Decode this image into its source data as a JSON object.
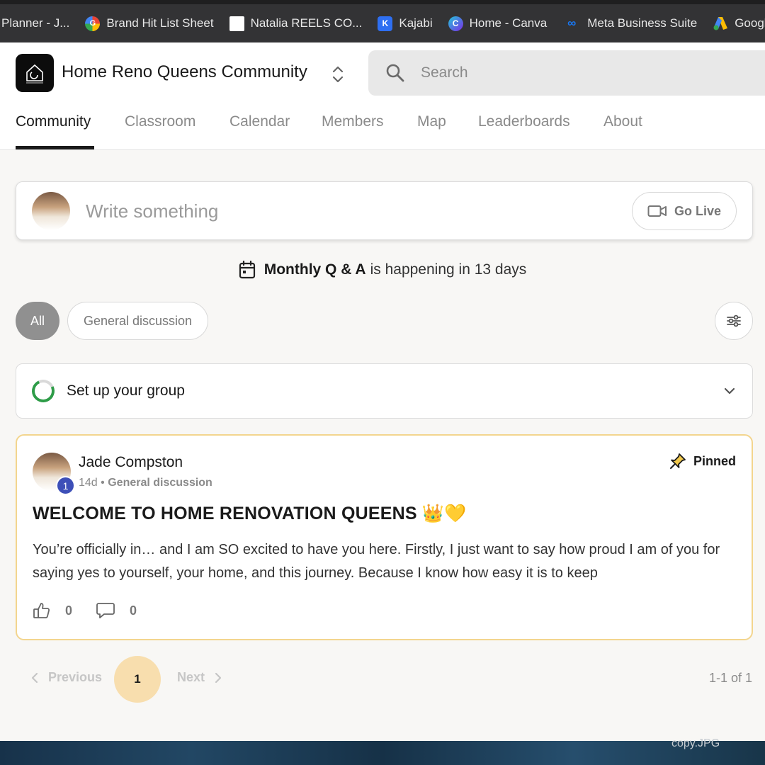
{
  "bookmarks": [
    {
      "label": "Planner - J...",
      "icon": "none"
    },
    {
      "label": "Brand Hit List Sheet",
      "icon": "google-icon"
    },
    {
      "label": "Natalia REELS CO...",
      "icon": "page-icon"
    },
    {
      "label": "Kajabi",
      "icon": "kajabi-icon"
    },
    {
      "label": "Home - Canva",
      "icon": "canva-icon"
    },
    {
      "label": "Meta Business Suite",
      "icon": "meta-icon"
    },
    {
      "label": "Google",
      "icon": "google-ads-icon"
    }
  ],
  "header": {
    "group_name": "Home Reno Queens Community",
    "search_placeholder": "Search"
  },
  "tabs": [
    {
      "label": "Community",
      "active": true
    },
    {
      "label": "Classroom"
    },
    {
      "label": "Calendar"
    },
    {
      "label": "Members"
    },
    {
      "label": "Map"
    },
    {
      "label": "Leaderboards"
    },
    {
      "label": "About"
    }
  ],
  "composer": {
    "placeholder": "Write something",
    "go_live": "Go Live"
  },
  "event": {
    "name": "Monthly Q & A",
    "suffix": "is happening in 13 days"
  },
  "filters": {
    "all": "All",
    "general": "General discussion"
  },
  "setup": {
    "label": "Set up your group"
  },
  "post": {
    "author": "Jade Compston",
    "level": "1",
    "age": "14d",
    "separator": "•",
    "category": "General discussion",
    "pinned": "Pinned",
    "title": "WELCOME TO HOME RENOVATION QUEENS 👑💛",
    "body": "You’re officially in… and I am SO excited to have you here. Firstly, I just want to say how proud I am of you for saying yes to yourself, your home, and this journey. Because I know how easy it is to keep",
    "likes": "0",
    "comments": "0"
  },
  "pagination": {
    "previous": "Previous",
    "current": "1",
    "next": "Next",
    "range": "1-1 of 1"
  },
  "footer": {
    "filename": "copy.JPG"
  },
  "colors": {
    "accent_green": "#2e9c48",
    "pinned_border": "#f3d58e",
    "page_highlight": "#f8deae",
    "badge_blue": "#3d4fb8"
  }
}
